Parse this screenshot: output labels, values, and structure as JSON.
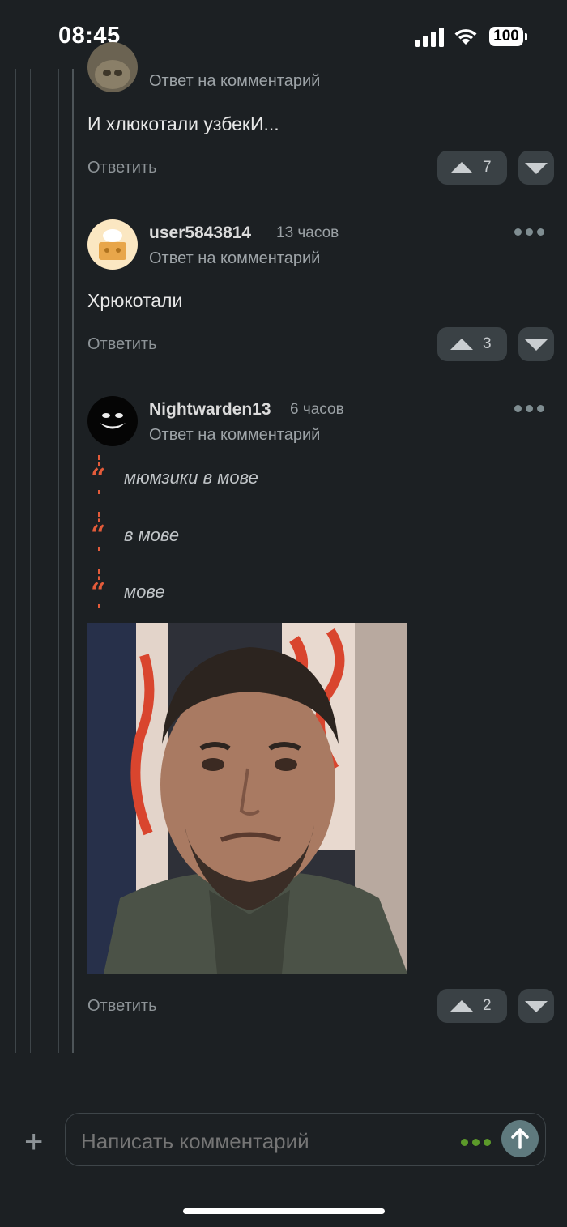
{
  "status_bar": {
    "time": "08:45",
    "battery": "100"
  },
  "comments": [
    {
      "reply_to": "Ответ на комментарий",
      "text": "И хлюкотали узбекИ...",
      "reply_label": "Ответить",
      "votes": "7"
    },
    {
      "username": "user5843814",
      "age": "13 часов",
      "reply_to": "Ответ на комментарий",
      "text": "Хрюкотали",
      "reply_label": "Ответить",
      "votes": "3"
    },
    {
      "username": "Nightwarden13",
      "age": "6 часов",
      "reply_to": "Ответ на комментарий",
      "quotes": [
        "мюмзики в мове",
        "в мове",
        "мове"
      ],
      "reply_label": "Ответить",
      "votes": "2"
    }
  ],
  "composer": {
    "placeholder": "Написать комментарий"
  },
  "icons": {
    "add": "plus-icon",
    "send": "arrow-up-icon",
    "more": "more-dots-icon",
    "upvote": "triangle-up-icon",
    "downvote": "triangle-down-icon"
  },
  "colors": {
    "background": "#1c2023",
    "quote_accent": "#e35b3a",
    "send_button": "#5f7a7e",
    "typing_dots": "#5c9a2a"
  }
}
